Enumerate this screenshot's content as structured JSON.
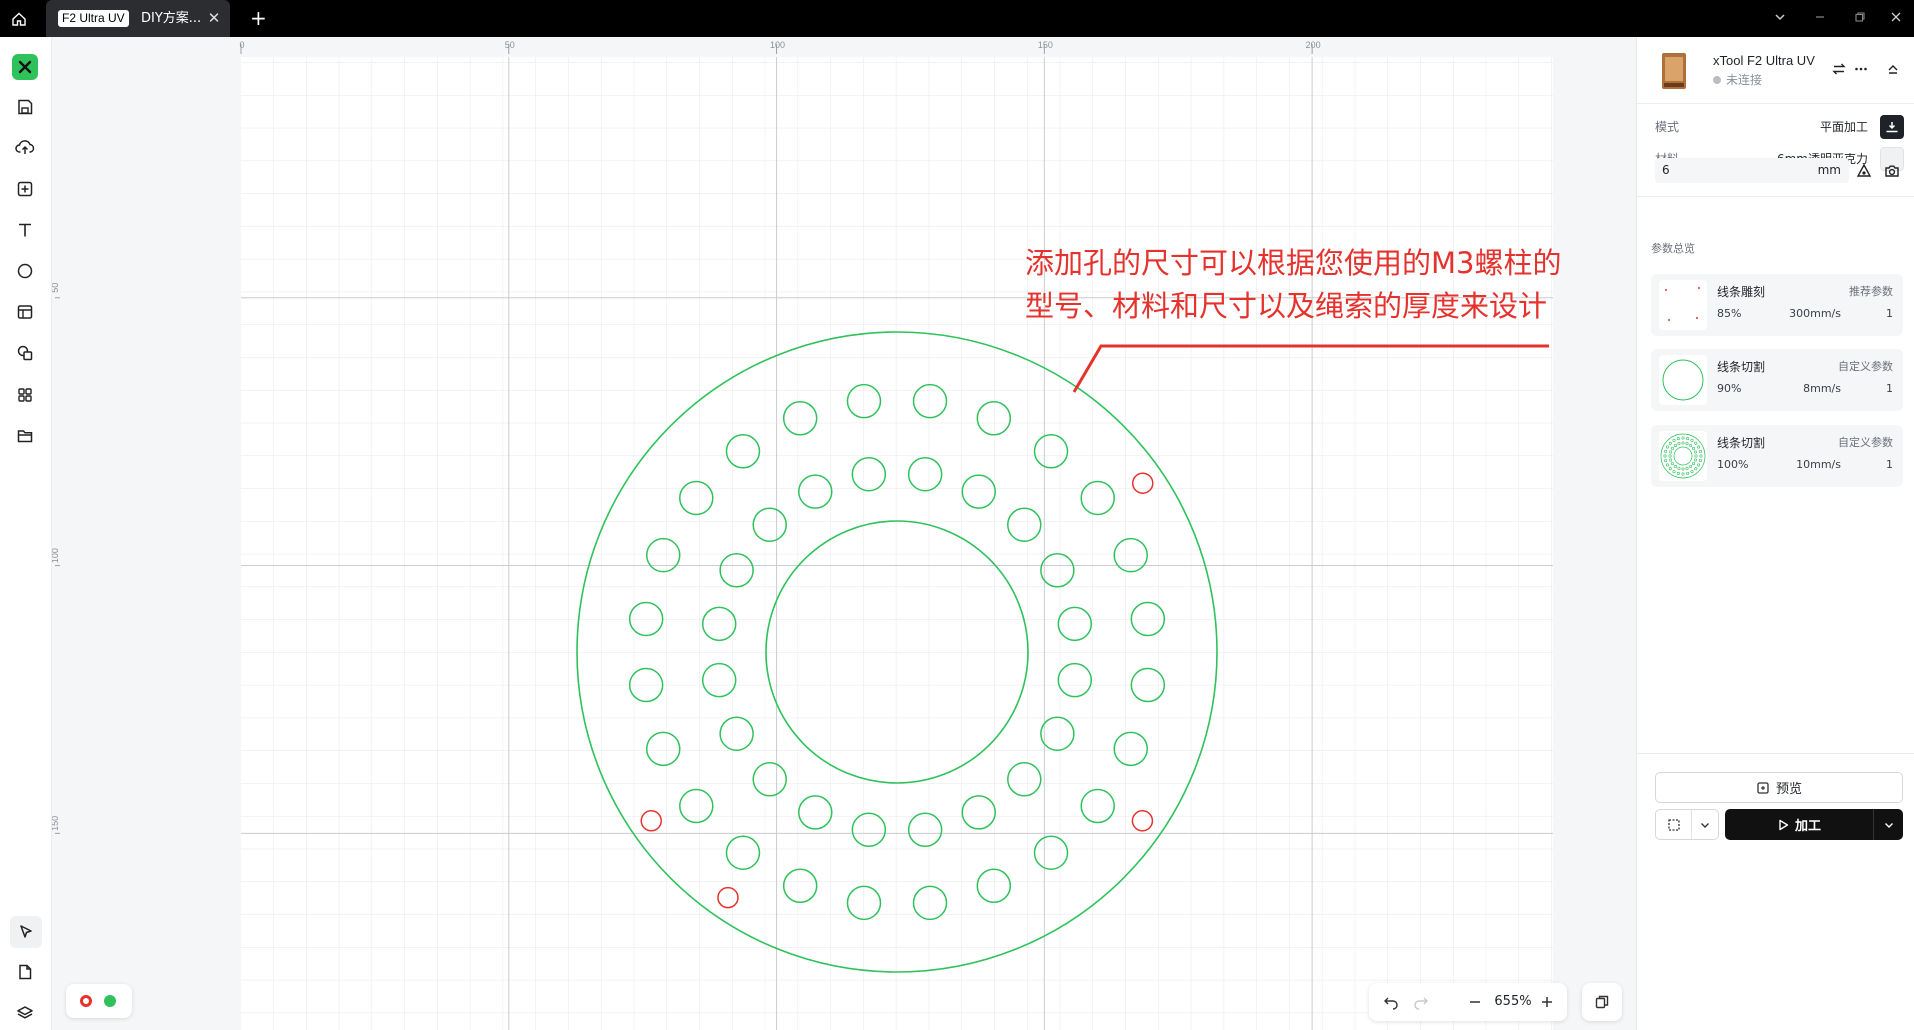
{
  "titlebar": {
    "tab_badge": "F2 Ultra UV",
    "tab_title": "DIY方案...",
    "close_glyph": "✕",
    "add_glyph": "+"
  },
  "toolbar_icons": [
    "xtool-logo-icon",
    "save-icon",
    "cloud-upload-icon",
    "add-box-icon",
    "text-icon",
    "shape-icon",
    "layout-icon",
    "element-library-icon",
    "apps-icon",
    "folder-icon",
    "select-pointer-icon",
    "document-icon",
    "layers-icon"
  ],
  "canvas": {
    "ruler_top_labels": [
      "0",
      "50",
      "100",
      "150",
      "200"
    ],
    "ruler_left_labels": [
      "50",
      "100",
      "150"
    ],
    "stroke_green": "#2fc25b",
    "stroke_red": "#e5322d",
    "annotation_lines": [
      "添加孔的尺寸可以根据您使用的M3螺柱的",
      "型号、材料和尺寸以及绳索的厚度来设计"
    ]
  },
  "zoom": {
    "value": "655%"
  },
  "device": {
    "name": "xTool F2 Ultra UV",
    "status": "未连接"
  },
  "settings": {
    "mode_label": "模式",
    "mode_value": "平面加工",
    "material_label": "材料",
    "material_value": "6mm透明亚克力",
    "thickness_value": "6",
    "thickness_unit": "mm"
  },
  "params": {
    "section_title": "参数总览",
    "layers": [
      {
        "name": "线条雕刻",
        "tag": "推荐参数",
        "power": "85%",
        "speed": "300mm/s",
        "passes": "1"
      },
      {
        "name": "线条切割",
        "tag": "自定义参数",
        "power": "90%",
        "speed": "8mm/s",
        "passes": "1"
      },
      {
        "name": "线条切割",
        "tag": "自定义参数",
        "power": "100%",
        "speed": "10mm/s",
        "passes": "1"
      }
    ]
  },
  "actions": {
    "preview_label": "预览",
    "process_label": "加工"
  }
}
